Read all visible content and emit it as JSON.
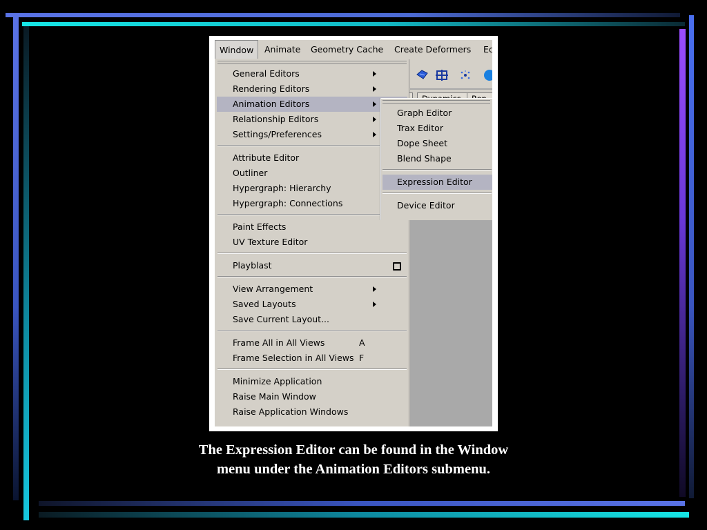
{
  "menubar": {
    "items": [
      "Window",
      "Animate",
      "Geometry Cache",
      "Create Deformers",
      "Ec"
    ]
  },
  "tabs": [
    "Dynamics",
    "Ren"
  ],
  "window_menu": {
    "items": [
      {
        "label": "General Editors",
        "has_submenu": true
      },
      {
        "label": "Rendering Editors",
        "has_submenu": true
      },
      {
        "label": "Animation Editors",
        "has_submenu": true,
        "highlighted": true
      },
      {
        "label": "Relationship Editors",
        "has_submenu": true
      },
      {
        "label": "Settings/Preferences",
        "has_submenu": true
      },
      {
        "label": "Attribute Editor"
      },
      {
        "label": "Outliner"
      },
      {
        "label": "Hypergraph: Hierarchy"
      },
      {
        "label": "Hypergraph: Connections"
      },
      {
        "label": "Paint Effects"
      },
      {
        "label": "UV Texture Editor"
      },
      {
        "label": "Playblast",
        "has_option_box": true
      },
      {
        "label": "View Arrangement",
        "has_submenu": true
      },
      {
        "label": "Saved Layouts",
        "has_submenu": true
      },
      {
        "label": "Save Current Layout..."
      },
      {
        "label": "Frame All in All Views",
        "shortcut": "A"
      },
      {
        "label": "Frame Selection in All Views",
        "shortcut": "F"
      },
      {
        "label": "Minimize Application"
      },
      {
        "label": "Raise Main Window"
      },
      {
        "label": "Raise Application Windows"
      }
    ]
  },
  "animation_editors_submenu": {
    "items": [
      {
        "label": "Graph Editor"
      },
      {
        "label": "Trax Editor"
      },
      {
        "label": "Dope Sheet"
      },
      {
        "label": "Blend Shape"
      },
      {
        "label": "Expression Editor",
        "highlighted": true
      },
      {
        "label": "Device Editor"
      }
    ]
  },
  "caption": {
    "line1": "The Expression Editor can be found in the Window",
    "line2": "menu under the Animation Editors submenu."
  },
  "colors": {
    "menu_bg": "#d4d0c8",
    "highlight": "#b4b4c2",
    "slide_bg": "#000000",
    "caption": "#ffffff"
  }
}
